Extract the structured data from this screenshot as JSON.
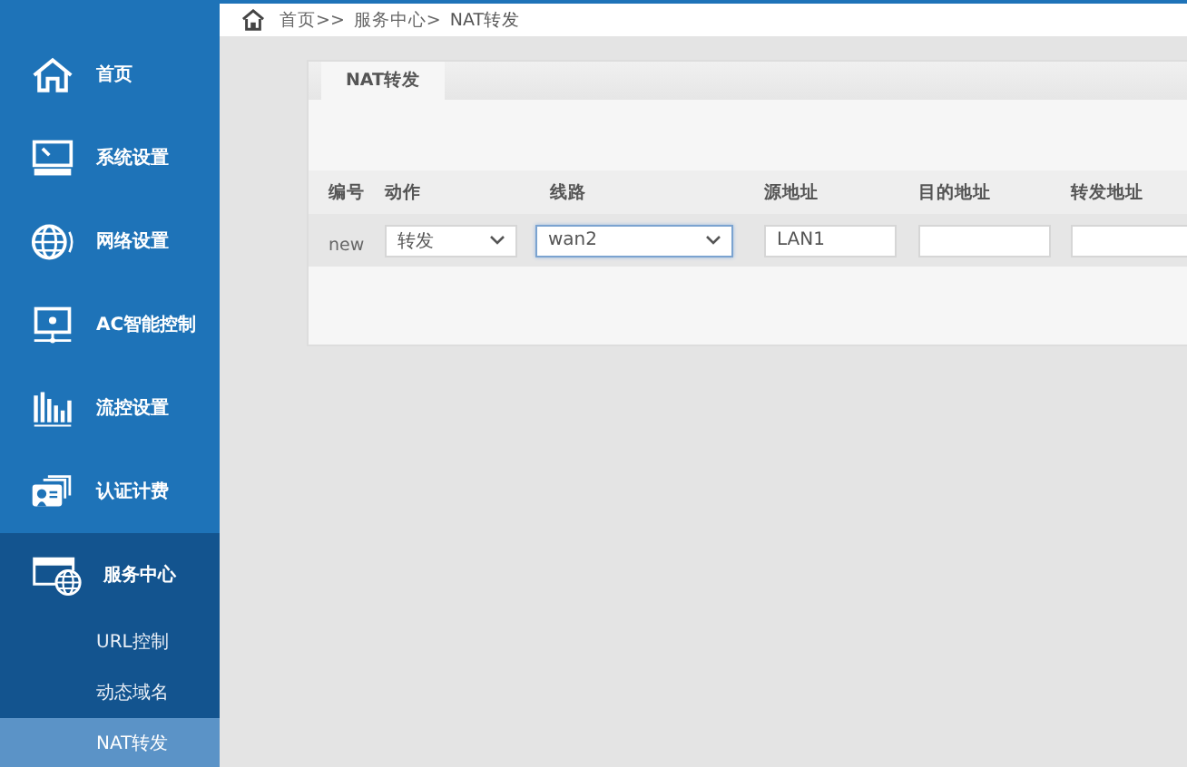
{
  "breadcrumb": [
    "首页>>",
    "服务中心>",
    "NAT转发"
  ],
  "sidebar": {
    "items": [
      {
        "label": "首页",
        "selected": false,
        "expanded": false
      },
      {
        "label": "系统设置",
        "selected": false,
        "expanded": false
      },
      {
        "label": "网络设置",
        "selected": false,
        "expanded": false
      },
      {
        "label": "AC智能控制",
        "selected": false,
        "expanded": false
      },
      {
        "label": "流控设置",
        "selected": false,
        "expanded": false
      },
      {
        "label": "认证计费",
        "selected": false,
        "expanded": false
      },
      {
        "label": "服务中心",
        "selected": false,
        "expanded": true,
        "children": [
          {
            "label": "URL控制",
            "selected": false
          },
          {
            "label": "动态域名",
            "selected": false
          },
          {
            "label": "NAT转发",
            "selected": true
          }
        ]
      }
    ]
  },
  "tabs": [
    {
      "label": "NAT转发",
      "selected": true
    }
  ],
  "table": {
    "columns": [
      "编号",
      "动作",
      "线路",
      "源地址",
      "目的地址",
      "转发地址"
    ],
    "rows": [
      [
        {
          "kind": "text",
          "value": "new"
        },
        {
          "kind": "select",
          "value": "转发",
          "focused": false
        },
        {
          "kind": "select",
          "value": "wan2",
          "focused": true
        },
        {
          "kind": "input",
          "value": "LAN1",
          "focused": false
        },
        {
          "kind": "input",
          "focused": false
        },
        {
          "kind": "input",
          "focused": false
        }
      ]
    ]
  }
}
